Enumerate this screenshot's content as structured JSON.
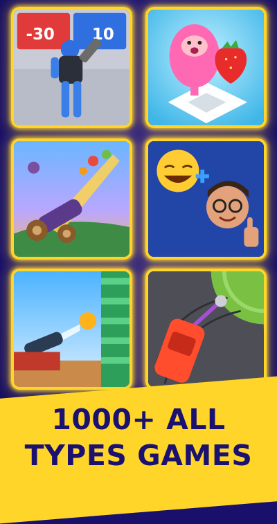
{
  "tiles": [
    {
      "name": "army-runner-game",
      "label_left": "-30",
      "label_right": "10"
    },
    {
      "name": "jelly-strawberry-game"
    },
    {
      "name": "cannon-fruit-game"
    },
    {
      "name": "emoji-match-game"
    },
    {
      "name": "ball-tower-cannon-game"
    },
    {
      "name": "car-drift-game"
    }
  ],
  "headline": {
    "line1": "1000+ ALL",
    "line2": "TYPES GAMES"
  },
  "colors": {
    "background": "#1b1272",
    "tile_border": "#ffd52a",
    "banner": "#ffd52a",
    "headline_text": "#1a1170"
  }
}
